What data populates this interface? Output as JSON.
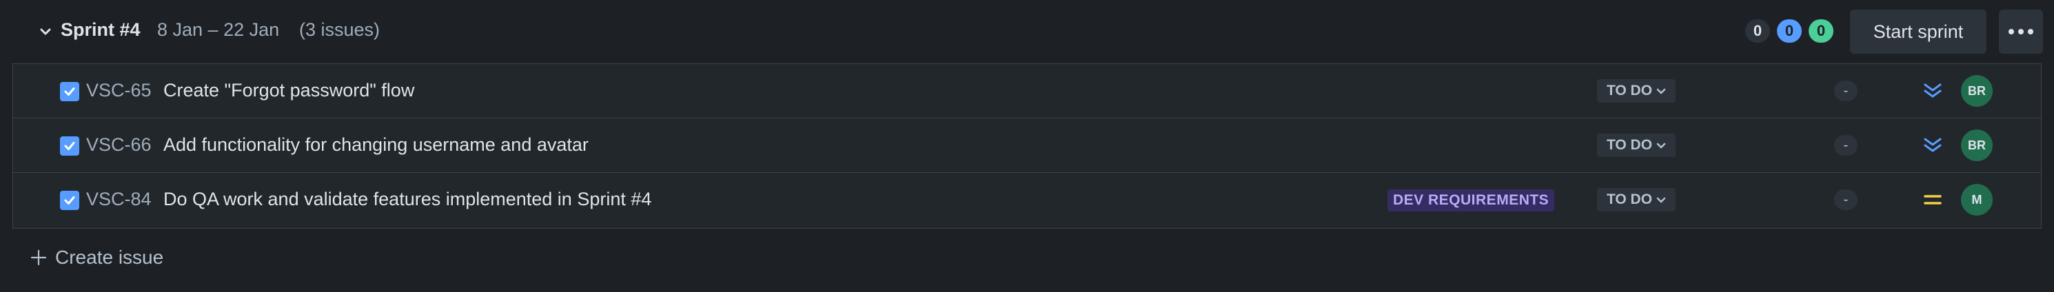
{
  "sprint": {
    "title": "Sprint #4",
    "dates": "8 Jan – 22 Jan",
    "count": "(3 issues)",
    "todo_points": "0",
    "in_progress_points": "0",
    "done_points": "0",
    "start_label": "Start sprint"
  },
  "issues": [
    {
      "key": "VSC-65",
      "summary": "Create \"Forgot password\" flow",
      "epic": "",
      "status": "TO DO",
      "estimate": "-",
      "priority": "lowest",
      "assignee": "BR"
    },
    {
      "key": "VSC-66",
      "summary": "Add functionality for changing username and avatar",
      "epic": "",
      "status": "TO DO",
      "estimate": "-",
      "priority": "lowest",
      "assignee": "BR"
    },
    {
      "key": "VSC-84",
      "summary": "Do QA work and validate features implemented in Sprint #4",
      "epic": "DEV REQUIREMENTS",
      "status": "TO DO",
      "estimate": "-",
      "priority": "medium",
      "assignee": "M"
    }
  ],
  "create_issue_label": "Create issue",
  "colors": {
    "background": "#1d2125",
    "row": "#22272b",
    "checkbox": "#579dff",
    "priority_lowest": "#579dff",
    "priority_medium": "#f5cd47",
    "avatar": "#216e4e",
    "epic_bg": "#352c63",
    "epic_text": "#b8acf6"
  }
}
